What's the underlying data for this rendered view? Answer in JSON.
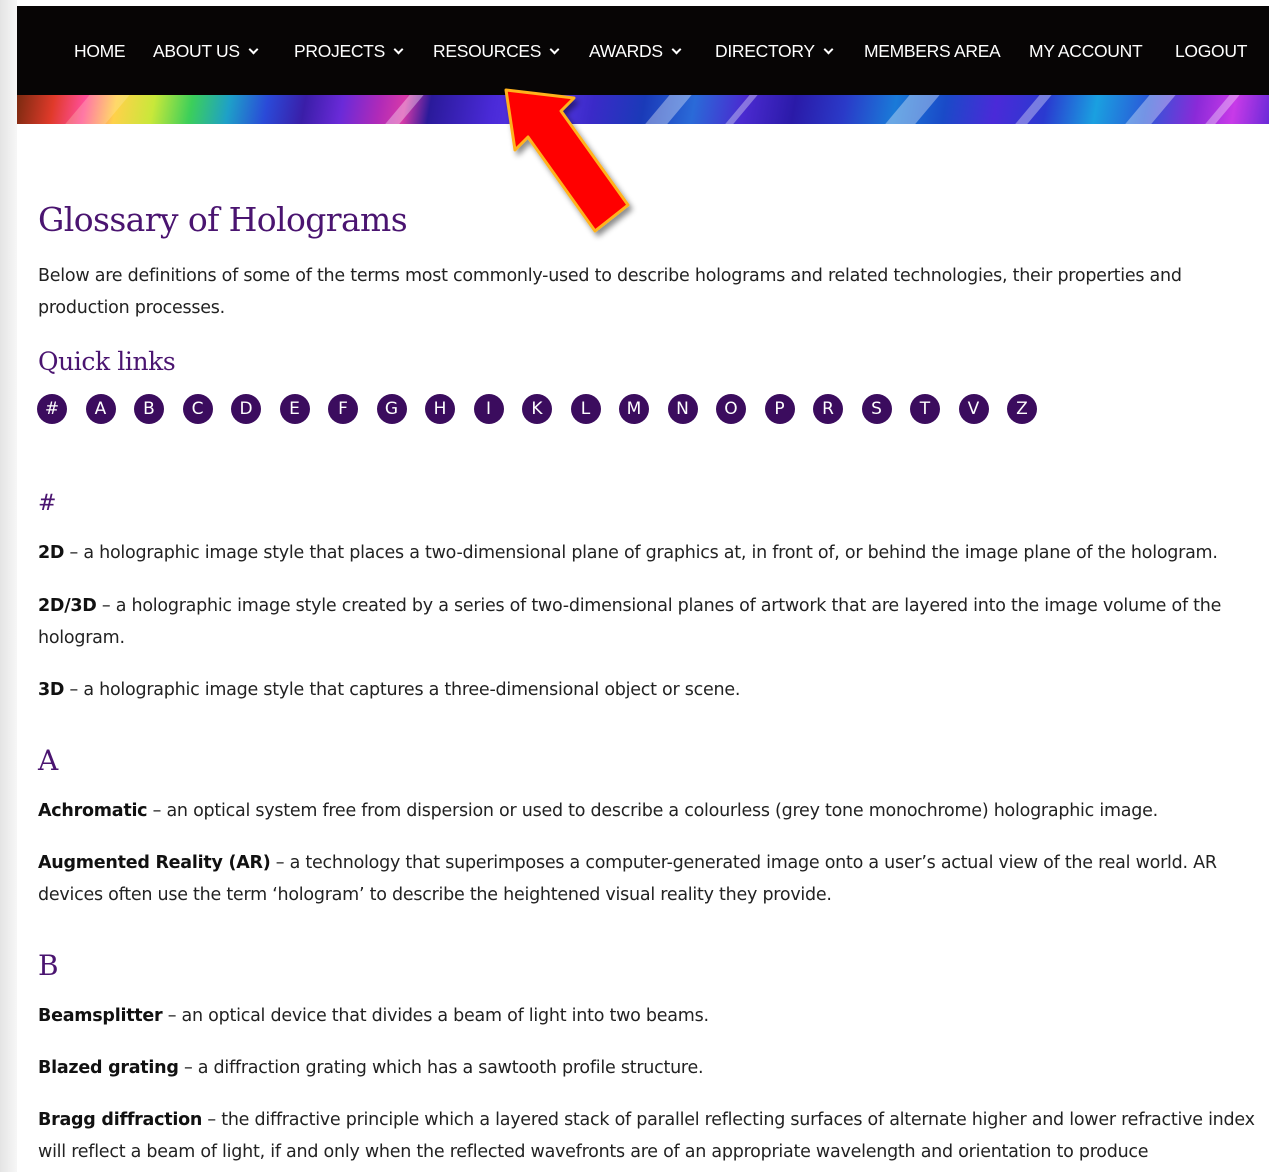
{
  "nav": {
    "items": [
      {
        "label": "HOME",
        "dropdown": false
      },
      {
        "label": "ABOUT US",
        "dropdown": true
      },
      {
        "label": "PROJECTS",
        "dropdown": true
      },
      {
        "label": "RESOURCES",
        "dropdown": true
      },
      {
        "label": "AWARDS",
        "dropdown": true
      },
      {
        "label": "DIRECTORY",
        "dropdown": true
      },
      {
        "label": "MEMBERS AREA",
        "dropdown": false
      },
      {
        "label": "MY ACCOUNT",
        "dropdown": false
      },
      {
        "label": "LOGOUT",
        "dropdown": false
      }
    ]
  },
  "colors": {
    "navbar_bg": "#070505",
    "heading": "#4a1470",
    "quick_link_bg": "#3b0c5e",
    "arrow": "#ff0000",
    "arrow_outline": "#ffb21a"
  },
  "annotation": {
    "icon": "red-arrow-icon",
    "points_to": "RESOURCES"
  },
  "page": {
    "title": "Glossary of Holograms",
    "intro": "Below are definitions of some of the terms most commonly-used to describe holograms and related technologies, their properties and production processes.",
    "quick_links_title": "Quick links",
    "quick_links": [
      "#",
      "A",
      "B",
      "C",
      "D",
      "E",
      "F",
      "G",
      "H",
      "I",
      "K",
      "L",
      "M",
      "N",
      "O",
      "P",
      "R",
      "S",
      "T",
      "V",
      "Z"
    ]
  },
  "sections": [
    {
      "letter": "#",
      "entries": [
        {
          "term": "2D",
          "definition": " – a holographic image style that places a two-dimensional plane of graphics at, in front of, or behind the image plane of the hologram."
        },
        {
          "term": "2D/3D",
          "definition": " – a holographic image style created by a series of two-dimensional planes of artwork that are layered into the image volume of the hologram."
        },
        {
          "term": "3D",
          "definition": " – a holographic image style that captures a three-dimensional object or scene."
        }
      ]
    },
    {
      "letter": "A",
      "entries": [
        {
          "term": "Achromatic",
          "definition": " – an optical system free from dispersion or used to describe a colourless (grey tone monochrome) holographic image."
        },
        {
          "term": "Augmented Reality (AR)",
          "definition": " – a technology that superimposes a computer-generated image onto a user’s actual view of the real world. AR devices often use the term ‘hologram’ to describe the heightened visual reality they provide."
        }
      ]
    },
    {
      "letter": "B",
      "entries": [
        {
          "term": "Beamsplitter",
          "definition": " – an optical device that divides a beam of light into two beams."
        },
        {
          "term": "Blazed grating",
          "definition": " – a diffraction grating which has a sawtooth profile structure."
        },
        {
          "term": "Bragg diffraction",
          "definition": " – the diffractive principle which a layered stack of parallel reflecting surfaces of alternate higher and lower refractive index will reflect a beam of light, if and only when the reflected wavefronts are of an appropriate wavelength and orientation to produce"
        }
      ]
    }
  ]
}
